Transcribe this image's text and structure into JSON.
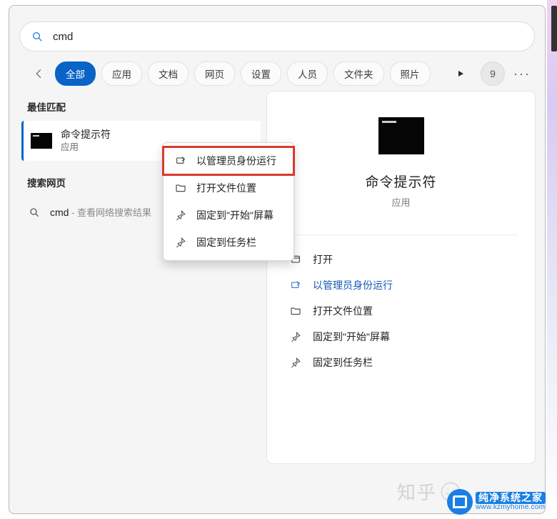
{
  "search": {
    "value": "cmd"
  },
  "filters": {
    "back_icon": "back",
    "tabs": [
      {
        "label": "全部",
        "active": true
      },
      {
        "label": "应用",
        "active": false
      },
      {
        "label": "文档",
        "active": false
      },
      {
        "label": "网页",
        "active": false
      },
      {
        "label": "设置",
        "active": false
      },
      {
        "label": "人员",
        "active": false
      },
      {
        "label": "文件夹",
        "active": false
      },
      {
        "label": "照片",
        "active": false
      }
    ],
    "badge_count": "9"
  },
  "results": {
    "best_match_header": "最佳匹配",
    "best_match": {
      "title": "命令提示符",
      "subtitle": "应用"
    },
    "web_header": "搜索网页",
    "web_item": {
      "query": "cmd",
      "hint": " - 查看网络搜索结果"
    }
  },
  "context_menu": {
    "items": [
      {
        "icon": "admin",
        "label": "以管理员身份运行",
        "highlight": true
      },
      {
        "icon": "folder",
        "label": "打开文件位置",
        "highlight": false
      },
      {
        "icon": "pin",
        "label": "固定到\"开始\"屏幕",
        "highlight": false
      },
      {
        "icon": "pin",
        "label": "固定到任务栏",
        "highlight": false
      }
    ]
  },
  "preview": {
    "title": "命令提示符",
    "subtitle": "应用",
    "actions": [
      {
        "icon": "open",
        "label": "打开"
      },
      {
        "icon": "admin",
        "label": "以管理员身份运行"
      },
      {
        "icon": "folder",
        "label": "打开文件位置"
      },
      {
        "icon": "pin",
        "label": "固定到\"开始\"屏幕"
      },
      {
        "icon": "pin",
        "label": "固定到任务栏"
      }
    ]
  },
  "watermarks": {
    "zhihu": "知乎",
    "site_cn": "纯净系统之家",
    "site_en": "www.kzmyhome.com"
  },
  "colors": {
    "accent": "#0a63c7",
    "highlight_ring": "#d93a2b"
  }
}
